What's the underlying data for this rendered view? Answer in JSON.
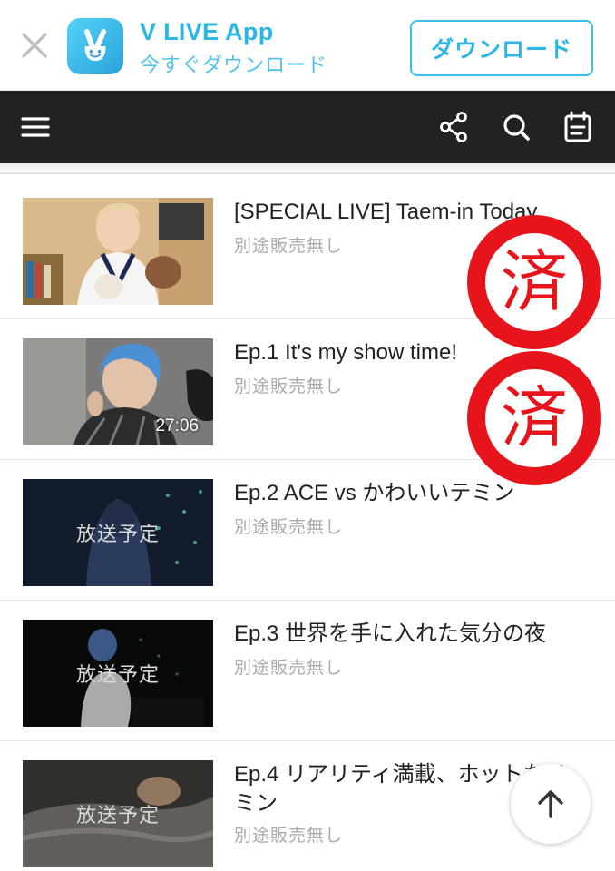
{
  "banner": {
    "app_name": "V LIVE App",
    "app_subtitle": "今すぐダウンロード",
    "download_label": "ダウンロード"
  },
  "nav": {
    "icons": [
      "menu-icon",
      "share-icon",
      "search-icon",
      "schedule-icon"
    ]
  },
  "videos": [
    {
      "title": "[SPECIAL LIVE] Taem-in Today",
      "meta": "別途販売無し",
      "duration": "",
      "overlay": ""
    },
    {
      "title": "Ep.1 It's my show time!",
      "meta": "別途販売無し",
      "duration": "27:06",
      "overlay": ""
    },
    {
      "title": "Ep.2 ACE vs かわいいテミン",
      "meta": "別途販売無し",
      "duration": "",
      "overlay": "放送予定"
    },
    {
      "title": "Ep.3 世界を手に入れた気分の夜",
      "meta": "別途販売無し",
      "duration": "",
      "overlay": "放送予定"
    },
    {
      "title": "Ep.4 リアリティ満載、ホットなテミン",
      "meta": "別途販売無し",
      "duration": "",
      "overlay": "放送予定"
    }
  ],
  "stamps": {
    "text": "済",
    "color": "#e8141c"
  },
  "colors": {
    "accent": "#2bb6e6",
    "nav_bg": "#222222"
  }
}
